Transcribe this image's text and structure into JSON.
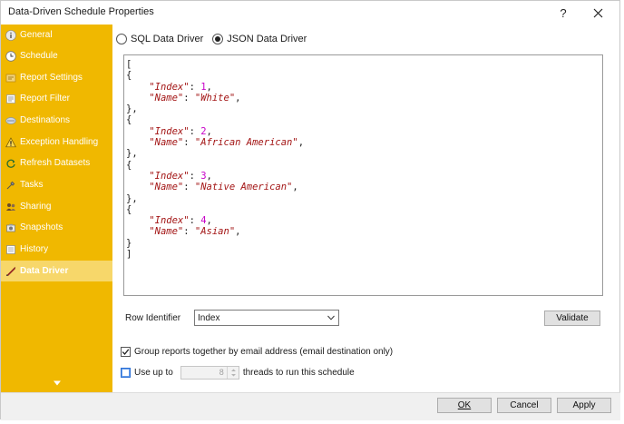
{
  "window": {
    "title": "Data-Driven Schedule Properties",
    "help_label": "?"
  },
  "sidebar": {
    "items": [
      {
        "label": "General",
        "icon": "info-icon"
      },
      {
        "label": "Schedule",
        "icon": "clock-icon"
      },
      {
        "label": "Report Settings",
        "icon": "settings-icon"
      },
      {
        "label": "Report Filter",
        "icon": "filter-icon"
      },
      {
        "label": "Destinations",
        "icon": "destinations-icon"
      },
      {
        "label": "Exception Handling",
        "icon": "warning-icon"
      },
      {
        "label": "Refresh Datasets",
        "icon": "refresh-icon"
      },
      {
        "label": "Tasks",
        "icon": "tasks-icon"
      },
      {
        "label": "Sharing",
        "icon": "sharing-icon"
      },
      {
        "label": "Snapshots",
        "icon": "snapshots-icon"
      },
      {
        "label": "History",
        "icon": "history-icon"
      },
      {
        "label": "Data Driver",
        "icon": "data-driver-icon",
        "active": true
      }
    ]
  },
  "driver": {
    "sql_label": "SQL Data Driver",
    "json_label": "JSON Data Driver",
    "selected": "json"
  },
  "editor": {
    "records": [
      {
        "index": "1",
        "name": "\"White\""
      },
      {
        "index": "2",
        "name": "\"African American\""
      },
      {
        "index": "3",
        "name": "\"Native American\""
      },
      {
        "index": "4",
        "name": "\"Asian\""
      }
    ],
    "index_key": "\"Index\"",
    "name_key": "\"Name\""
  },
  "row_identifier": {
    "label": "Row Identifier",
    "value": "Index"
  },
  "validate_label": "Validate",
  "options": {
    "group_label": "Group reports together by email address (email destination only)",
    "group_checked": true,
    "use_up_to_label": "Use up to",
    "threads_value": "8",
    "threads_suffix": "threads to run this schedule",
    "use_up_to_checked": false
  },
  "footer": {
    "ok": "OK",
    "cancel": "Cancel",
    "apply": "Apply"
  },
  "colors": {
    "sidebar": "#f0b800",
    "sidebar_active": "#f7d76a",
    "json_key": "#a31515",
    "json_number": "#c800c8"
  }
}
